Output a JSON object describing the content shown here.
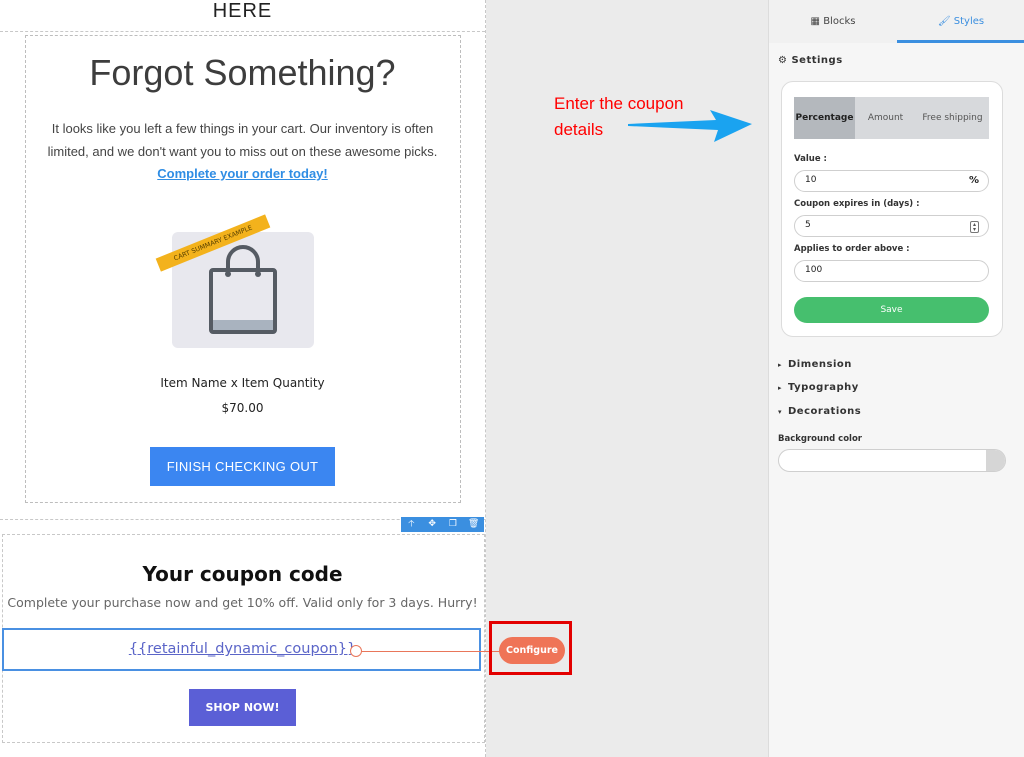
{
  "email": {
    "heading_tail": "HERE",
    "forgot_title": "Forgot Something?",
    "paragraph": "It looks like you left a few things in your cart. Our inventory is often limited, and we don't want you to miss out on these awesome picks.",
    "complete_link": "Complete your order today!",
    "product_ribbon": "CART SUMMARY EXAMPLE",
    "item_name": "Item Name x Item Quantity",
    "price": "$70.00",
    "finish_button": "FINISH CHECKING OUT",
    "coupon_title": "Your coupon code",
    "coupon_subtitle": "Complete your purchase now and get 10% off. Valid only for 3 days. Hurry!",
    "coupon_code": "{{retainful_dynamic_coupon}}",
    "configure_button": "Configure",
    "shop_button": "SHOP NOW!"
  },
  "toolbar": {
    "icons": [
      "arrow-up-icon",
      "move-icon",
      "copy-icon",
      "trash-icon"
    ]
  },
  "annotation": {
    "line1": "Enter the coupon",
    "line2": "details"
  },
  "panel": {
    "tabs": [
      {
        "label": "Blocks",
        "icon": "grid-icon",
        "active": false
      },
      {
        "label": "Styles",
        "icon": "brush-icon",
        "active": true
      }
    ],
    "settings_title": "Settings",
    "coupon_types": [
      {
        "label": "Percentage",
        "active": true
      },
      {
        "label": "Amount",
        "active": false
      },
      {
        "label": "Free shipping",
        "active": false
      }
    ],
    "value_label": "Value :",
    "value": "10",
    "value_suffix": "%",
    "expires_label": "Coupon expires in (days) :",
    "expires_value": "5",
    "applies_label": "Applies to order above :",
    "applies_value": "100",
    "save_button": "Save",
    "accordions": [
      {
        "label": "Dimension",
        "open": false
      },
      {
        "label": "Typography",
        "open": false
      },
      {
        "label": "Decorations",
        "open": true
      }
    ],
    "background_color_label": "Background color"
  },
  "colors": {
    "accent_blue": "#3b8fe0",
    "finish_button": "#3b86f1",
    "configure_button": "#ef7457",
    "shop_button": "#5b5fd6",
    "save_button": "#46bf6e",
    "annotation_red": "#ff0000",
    "highlight_frame": "#e30000",
    "ribbon": "#f3b21c"
  }
}
